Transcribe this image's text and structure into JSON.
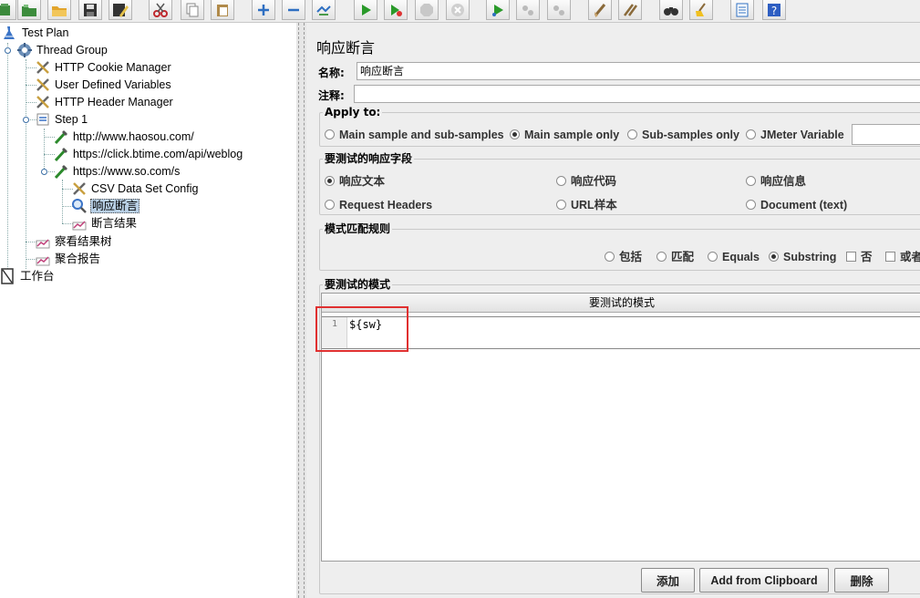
{
  "toolbar": {
    "buttons": [
      {
        "id": "templates",
        "icon": "templates-icon"
      },
      {
        "id": "open",
        "icon": "open-folder-icon"
      },
      {
        "id": "save",
        "icon": "save-icon"
      },
      {
        "id": "save-as",
        "icon": "save-as-icon"
      },
      {
        "id": "cut",
        "icon": "cut-icon"
      },
      {
        "id": "copy",
        "icon": "copy-icon"
      },
      {
        "id": "paste",
        "icon": "paste-icon"
      },
      {
        "id": "expand",
        "icon": "plus-icon"
      },
      {
        "id": "collapse",
        "icon": "minus-icon"
      },
      {
        "id": "toggle",
        "icon": "toggle-icon"
      },
      {
        "id": "start",
        "icon": "play-icon"
      },
      {
        "id": "start-no-pause",
        "icon": "play-no-pause-icon"
      },
      {
        "id": "stop",
        "icon": "stop-icon"
      },
      {
        "id": "shutdown",
        "icon": "shutdown-icon"
      },
      {
        "id": "remote-start",
        "icon": "remote-start-icon"
      },
      {
        "id": "remote-stop",
        "icon": "remote-stop-icon"
      },
      {
        "id": "remote-shutdown",
        "icon": "remote-shutdown-icon"
      },
      {
        "id": "clear",
        "icon": "clear-icon"
      },
      {
        "id": "clear-all",
        "icon": "clear-all-icon"
      },
      {
        "id": "search",
        "icon": "binoculars-icon"
      },
      {
        "id": "reset-search",
        "icon": "broom-icon"
      },
      {
        "id": "function-helper",
        "icon": "function-list-icon"
      },
      {
        "id": "help",
        "icon": "help-icon"
      }
    ]
  },
  "tree": {
    "nodes": [
      {
        "label": "Test Plan",
        "icon": "test-plan-icon",
        "level": 0
      },
      {
        "label": "Thread Group",
        "icon": "thread-group-icon",
        "level": 1
      },
      {
        "label": "HTTP Cookie Manager",
        "icon": "config-wrench-icon",
        "level": 2
      },
      {
        "label": "User Defined Variables",
        "icon": "config-wrench-icon",
        "level": 2
      },
      {
        "label": "HTTP Header Manager",
        "icon": "config-wrench-icon",
        "level": 2
      },
      {
        "label": "Step 1",
        "icon": "transaction-controller-icon",
        "level": 2
      },
      {
        "label": "http://www.haosou.com/",
        "icon": "http-sampler-icon",
        "level": 3
      },
      {
        "label": "https://click.btime.com/api/weblog",
        "icon": "http-sampler-icon",
        "level": 3
      },
      {
        "label": "https://www.so.com/s",
        "icon": "http-sampler-icon",
        "level": 3
      },
      {
        "label": "CSV Data Set Config",
        "icon": "config-wrench-icon",
        "level": 4
      },
      {
        "label": "响应断言",
        "icon": "response-assertion-icon",
        "level": 4,
        "selected": true
      },
      {
        "label": "断言结果",
        "icon": "listener-graph-icon",
        "level": 4
      },
      {
        "label": "察看结果树",
        "icon": "listener-graph-icon",
        "level": 2
      },
      {
        "label": "聚合报告",
        "icon": "listener-graph-icon",
        "level": 2
      },
      {
        "label": "工作台",
        "icon": "workbench-icon",
        "level": 0
      }
    ]
  },
  "panel": {
    "title": "响应断言",
    "name_label": "名称:",
    "name_value": "响应断言",
    "comment_label": "注释:",
    "comment_value": "",
    "apply_to": {
      "title": "Apply to:",
      "options": [
        {
          "label": "Main sample and sub-samples",
          "checked": false
        },
        {
          "label": "Main sample only",
          "checked": true
        },
        {
          "label": "Sub-samples only",
          "checked": false
        },
        {
          "label": "JMeter Variable",
          "checked": false
        }
      ],
      "variable_value": ""
    },
    "field_to_test": {
      "title": "要测试的响应字段",
      "options": [
        {
          "label": "响应文本",
          "checked": true
        },
        {
          "label": "响应代码",
          "checked": false
        },
        {
          "label": "响应信息",
          "checked": false
        },
        {
          "label": "Request Headers",
          "checked": false
        },
        {
          "label": "URL样本",
          "checked": false
        },
        {
          "label": "Document (text)",
          "checked": false
        }
      ]
    },
    "matching_rules": {
      "title": "模式匹配规则",
      "options": [
        {
          "label": "包括",
          "checked": false
        },
        {
          "label": "匹配",
          "checked": false
        },
        {
          "label": "Equals",
          "checked": false
        },
        {
          "label": "Substring",
          "checked": true
        }
      ],
      "not_label": "否",
      "not_checked": false,
      "or_label": "或者",
      "or_checked": false
    },
    "patterns": {
      "title": "要测试的模式",
      "column_header": "要测试的模式",
      "rows": [
        {
          "line": "1",
          "value": "${sw}"
        }
      ]
    },
    "buttons": {
      "add": "添加",
      "add_clipboard": "Add from Clipboard",
      "delete": "删除"
    },
    "highlight_color": "#e03030"
  }
}
